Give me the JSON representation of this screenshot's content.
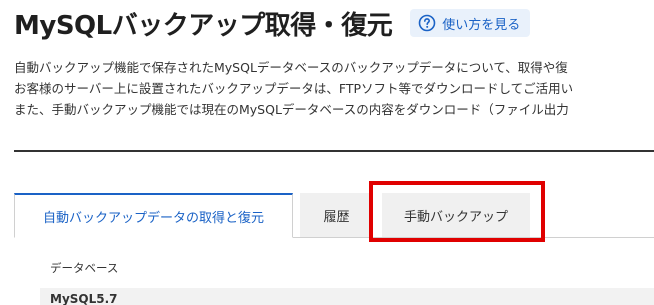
{
  "header": {
    "title": "MySQLバックアップ取得・復元",
    "help_label": "使い方を見る",
    "help_icon": "question-circle-icon"
  },
  "description": {
    "lines": [
      "自動バックアップ機能で保存されたMySQLデータベースのバックアップデータについて、取得や復",
      "お客様のサーバー上に設置されたバックアップデータは、FTPソフト等でダウンロードしてご活用い",
      "また、手動バックアップ機能では現在のMySQLデータベースの内容をダウンロード（ファイル出力"
    ]
  },
  "tabs": [
    {
      "label": "自動バックアップデータの取得と復元",
      "active": true
    },
    {
      "label": "履歴",
      "active": false
    },
    {
      "label": "手動バックアップ",
      "active": false
    }
  ],
  "table": {
    "column_label": "データベース",
    "first_row_value": "MySQL5.7"
  },
  "colors": {
    "accent": "#1a62c6",
    "highlight": "#e00000",
    "tab_inactive_bg": "#f0f0f0"
  }
}
